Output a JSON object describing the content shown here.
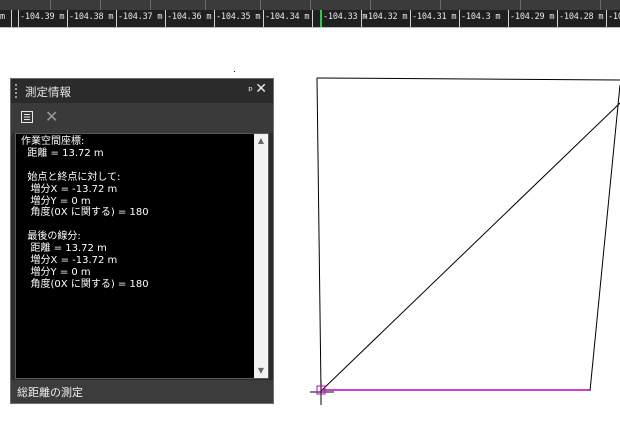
{
  "ruler": {
    "labels": [
      "m",
      "-104.39 m",
      "-104.38 m",
      "-104.37 m",
      "-104.36 m",
      "-104.35 m",
      "-104.34 m",
      "-104.33 m",
      "-104.32 m",
      "-104.31 m",
      "-104.3 m",
      "-104.29 m",
      "-104.28 m",
      "-104.2"
    ]
  },
  "panel": {
    "title": "測定情報",
    "pin_glyph": "ᵖ",
    "close_glyph": "✕",
    "clear_glyph": "✕",
    "output_lines": [
      "作業空間座標:",
      "  距離 = 13.72 m",
      "",
      "  始点と終点に対して:",
      "   増分X = -13.72 m",
      "   増分Y = 0 m",
      "   角度(0X に関する) = 180",
      "",
      "  最後の線分:",
      "   距離 = 13.72 m",
      "   増分X = -13.72 m",
      "   増分Y = 0 m",
      "   角度(0X に関する) = 180"
    ],
    "scroll_up_glyph": "▲",
    "scroll_down_glyph": "▼",
    "status": "総距離の測定"
  },
  "colors": {
    "measure_line": "#c000c0",
    "drawing_line": "#000000",
    "panel_bg": "#2b2b2b"
  }
}
